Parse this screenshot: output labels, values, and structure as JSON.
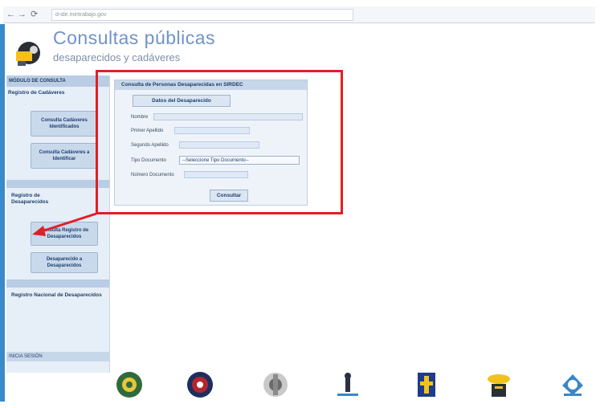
{
  "browser": {
    "url": "d-ide.mintrabajo.gov",
    "nav_back": "←",
    "nav_forward": "→",
    "nav_reload": "⟳"
  },
  "header": {
    "title": "Consultas públicas",
    "subtitle": "desaparecidos y cadáveres"
  },
  "sidebar": {
    "heading": "MÓDULO DE CONSULTA",
    "sections": [
      {
        "label": "Registro de Cadáveres",
        "buttons": [
          "Consulta Cadáveres Identificados",
          "Consulta Cadáveres a Identificar"
        ]
      },
      {
        "label": "Registro de Desaparecidos",
        "buttons": [
          "Consulta Registro de Desaparecidos",
          "Desaparecido a Desaparecidos"
        ]
      },
      {
        "label": "Registro Nacional de Desaparecidos",
        "buttons": []
      }
    ],
    "footer": "INICIA SESIÓN"
  },
  "panel": {
    "title": "Consulta de Personas Desaparecidas en SIRDEC",
    "top_button": "Datos del Desaparecido",
    "fields": [
      {
        "label": "Nombre",
        "value": ""
      },
      {
        "label": "Primer Apellido",
        "value": ""
      },
      {
        "label": "Segundo Apellido",
        "value": ""
      },
      {
        "label": "Tipo Documento",
        "value": "--Seleccione Tipo Documento--"
      },
      {
        "label": "Número Documento",
        "value": ""
      }
    ],
    "submit": "Consultar"
  },
  "colors": {
    "accent_red": "#e21e26",
    "sidebar_bg": "#e6eef7",
    "title_blue": "#6f93c9"
  },
  "footer_logos": [
    "policia-nacional-logo",
    "fuerza-aerea-logo",
    "ejercito-logo",
    "medicina-legal-logo",
    "fiscalia-logo",
    "registraduria-logo",
    "defensoria-logo"
  ]
}
